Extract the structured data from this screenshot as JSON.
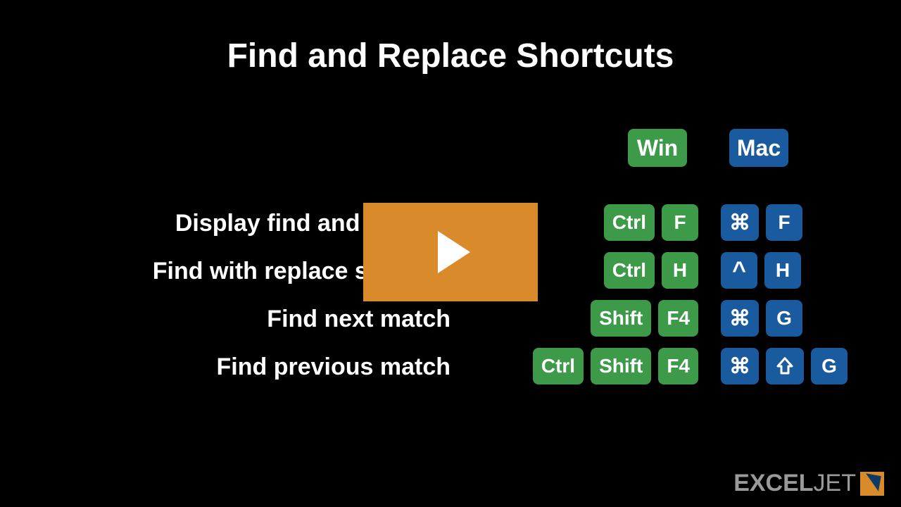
{
  "title": "Find and Replace Shortcuts",
  "headers": {
    "win": "Win",
    "mac": "Mac"
  },
  "rows": [
    {
      "label": "Display find and replace",
      "win": [
        "Ctrl",
        "F"
      ],
      "mac": [
        "⌘",
        "F"
      ]
    },
    {
      "label": "Find with replace selected",
      "win": [
        "Ctrl",
        "H"
      ],
      "mac": [
        "^",
        "H"
      ]
    },
    {
      "label": "Find next match",
      "win": [
        "Shift",
        "F4"
      ],
      "mac": [
        "⌘",
        "G"
      ]
    },
    {
      "label": "Find previous match",
      "win": [
        "Ctrl",
        "Shift",
        "F4"
      ],
      "mac": [
        "⌘",
        "⇧",
        "G"
      ]
    }
  ],
  "logo": {
    "excel": "EXCEL",
    "jet": "JET"
  }
}
